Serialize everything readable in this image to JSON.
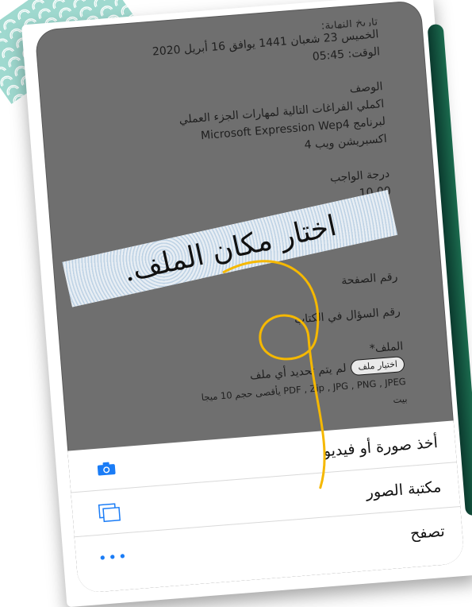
{
  "screen": {
    "date_line_partial": "تاريخ النهاية:",
    "date_line": "الخميس 23 شعبان 1441 يوافق 16 أبريل 2020",
    "time_line": "الوقت: 05:45",
    "description_label": "الوصف",
    "description_lines": [
      "اكملي الفراغات التالية لمهارات الجزء العملي",
      "لبرنامج Microsoft Expression Wep4",
      "اكسبريشن ويب 4"
    ],
    "grade_label": "درجة الواجب",
    "grade_value": "10.00",
    "page_number_label": "رقم الصفحة",
    "question_number_label": "رقم السؤال في الكتاب",
    "file_label": "الملف*",
    "choose_file_button": "اختيار ملف",
    "no_file_text": "لم يتم تحديد أي ملف",
    "file_types_text": "PDF , Zip , JPG , PNG , JPEG يأقصى حجم 10 ميجا",
    "byte_text": "بيت"
  },
  "banner": {
    "text": "اختار مكان الملف."
  },
  "action_sheet": {
    "items": [
      {
        "label": "أخذ صورة أو فيديو",
        "icon": "camera-icon"
      },
      {
        "label": "مكتبة الصور",
        "icon": "photo-library-icon"
      },
      {
        "label": "تصفح",
        "icon": "more-icon"
      }
    ]
  },
  "colors": {
    "accent": "#1a7cf6",
    "scribble": "#f5b800",
    "phone_bg": "#6f6f6f"
  }
}
